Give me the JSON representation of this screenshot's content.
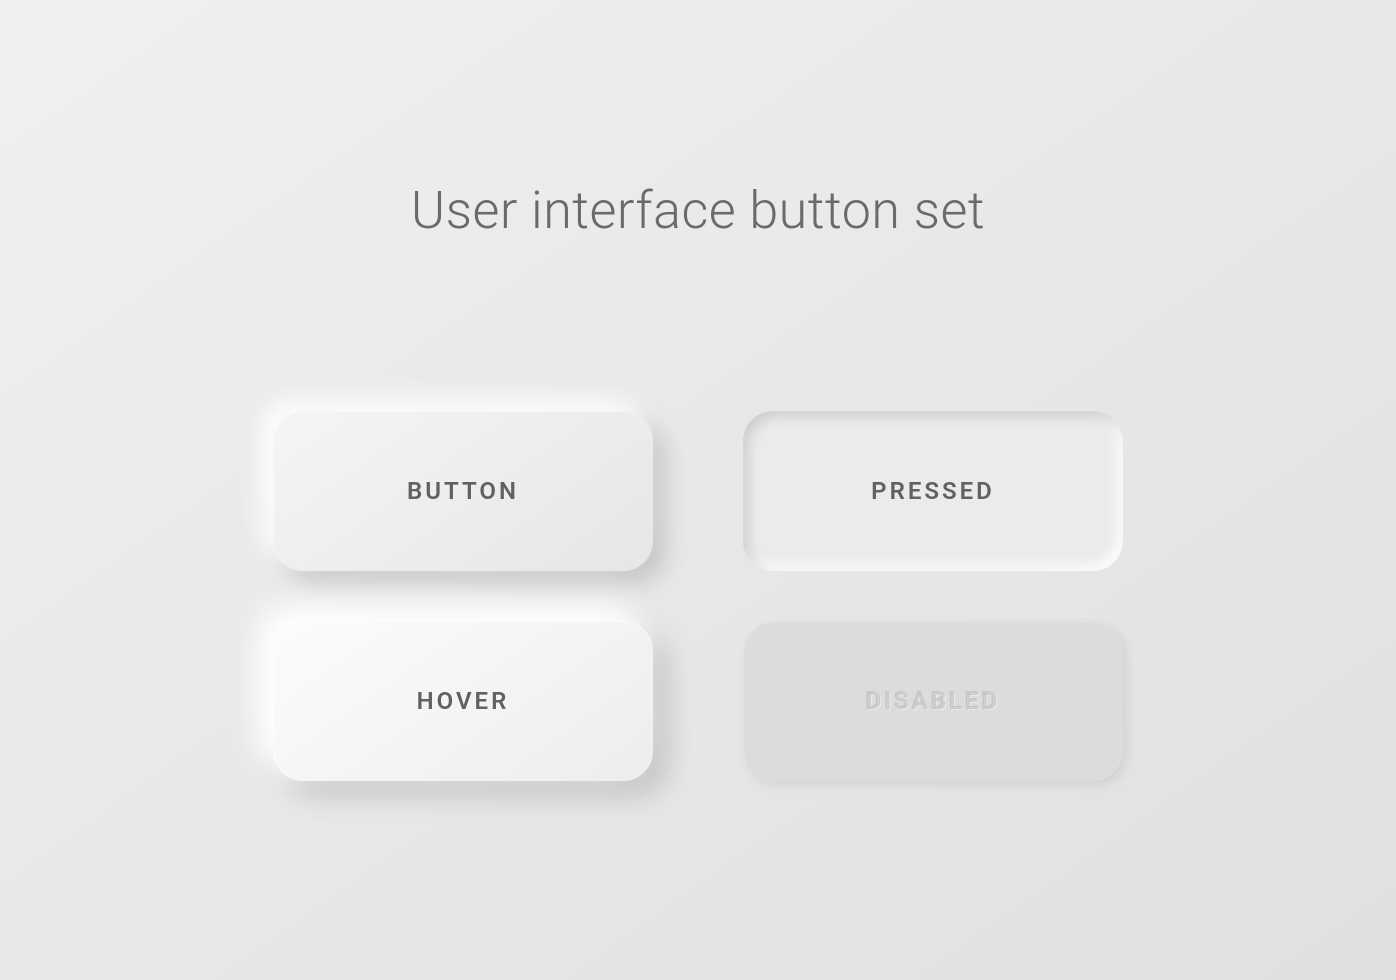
{
  "title": "User interface button set",
  "buttons": {
    "default": {
      "label": "BUTTON"
    },
    "pressed": {
      "label": "PRESSED"
    },
    "hover": {
      "label": "HOVER"
    },
    "disabled": {
      "label": "DISABLED"
    }
  }
}
